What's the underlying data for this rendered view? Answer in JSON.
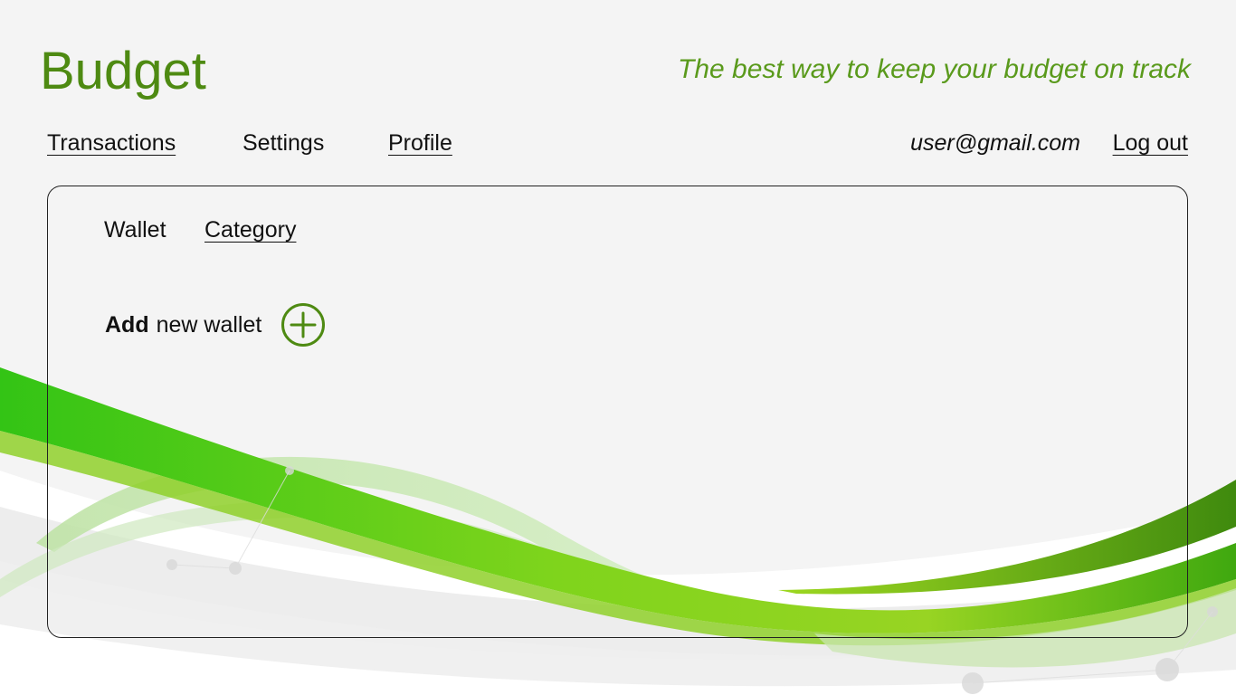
{
  "app": {
    "title": "Budget",
    "tagline": "The best way to keep your budget on track"
  },
  "nav": {
    "items": [
      {
        "label": "Transactions"
      },
      {
        "label": "Settings"
      },
      {
        "label": "Profile"
      }
    ]
  },
  "user": {
    "email": "user@gmail.com",
    "logout_label": "Log out"
  },
  "panel": {
    "tabs": [
      {
        "label": "Wallet"
      },
      {
        "label": "Category"
      }
    ],
    "add": {
      "label_strong": "Add",
      "label_rest": "new wallet",
      "icon": "plus-circle-icon"
    }
  },
  "colors": {
    "brand": "#4e8a12",
    "accent_green": "#5a9a1c",
    "background": "#f4f4f4"
  }
}
